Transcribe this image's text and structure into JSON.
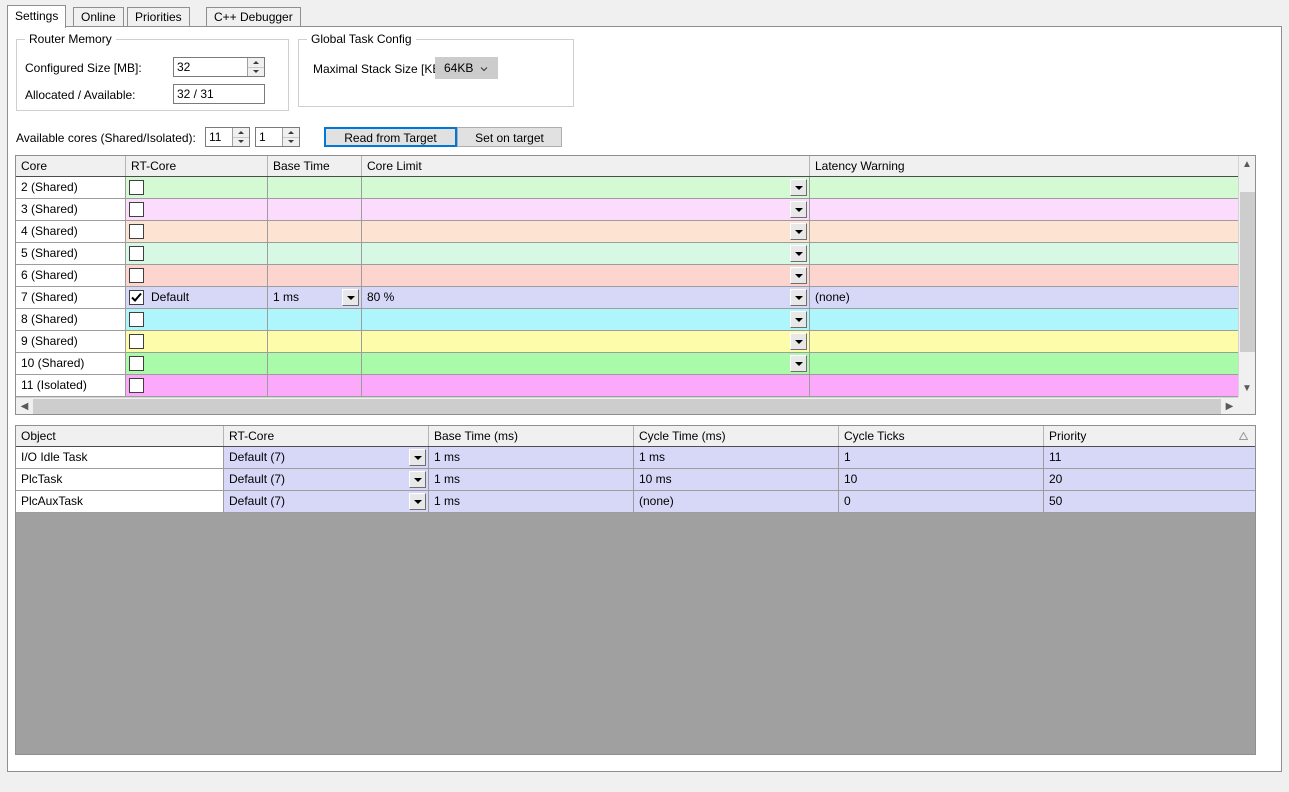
{
  "tabs": [
    {
      "label": "Settings",
      "active": true
    },
    {
      "label": "Online",
      "active": false
    },
    {
      "label": "Priorities",
      "active": false
    },
    {
      "label": "C++ Debugger",
      "active": false
    }
  ],
  "router_memory": {
    "title": "Router Memory",
    "configured_size_label": "Configured Size [MB]:",
    "configured_size_value": "32",
    "allocated_available_label": "Allocated / Available:",
    "allocated_available_value": "32 / 31"
  },
  "global_task_config": {
    "title": "Global Task Config",
    "max_stack_label": "Maximal Stack Size [KB]",
    "max_stack_value": "64KB"
  },
  "cores_row": {
    "label": "Available cores (Shared/Isolated):",
    "shared_value": "11",
    "isolated_value": "1",
    "read_button": "Read from Target",
    "set_button": "Set on target"
  },
  "core_table": {
    "columns": [
      "Core",
      "RT-Core",
      "Base Time",
      "Core Limit",
      "Latency Warning"
    ],
    "rows": [
      {
        "core": "2 (Shared)",
        "checked": false,
        "rt_core": "",
        "base_time": "",
        "core_limit": "",
        "latency_warning": "",
        "has_base_dropdown": false,
        "has_limit_dropdown": true,
        "color": "#d4fad4"
      },
      {
        "core": "3 (Shared)",
        "checked": false,
        "rt_core": "",
        "base_time": "",
        "core_limit": "",
        "latency_warning": "",
        "has_base_dropdown": false,
        "has_limit_dropdown": true,
        "color": "#fcdcfc"
      },
      {
        "core": "4 (Shared)",
        "checked": false,
        "rt_core": "",
        "base_time": "",
        "core_limit": "",
        "latency_warning": "",
        "has_base_dropdown": false,
        "has_limit_dropdown": true,
        "color": "#fde4d2"
      },
      {
        "core": "5 (Shared)",
        "checked": false,
        "rt_core": "",
        "base_time": "",
        "core_limit": "",
        "latency_warning": "",
        "has_base_dropdown": false,
        "has_limit_dropdown": true,
        "color": "#d6f8e5"
      },
      {
        "core": "6 (Shared)",
        "checked": false,
        "rt_core": "",
        "base_time": "",
        "core_limit": "",
        "latency_warning": "",
        "has_base_dropdown": false,
        "has_limit_dropdown": true,
        "color": "#fcd6ce"
      },
      {
        "core": "7 (Shared)",
        "checked": true,
        "rt_core": "Default",
        "base_time": "1 ms",
        "core_limit": "80 %",
        "latency_warning": "(none)",
        "has_base_dropdown": true,
        "has_limit_dropdown": true,
        "color": "#d7d7f8"
      },
      {
        "core": "8 (Shared)",
        "checked": false,
        "rt_core": "",
        "base_time": "",
        "core_limit": "",
        "latency_warning": "",
        "has_base_dropdown": false,
        "has_limit_dropdown": true,
        "color": "#aef5fc"
      },
      {
        "core": "9 (Shared)",
        "checked": false,
        "rt_core": "",
        "base_time": "",
        "core_limit": "",
        "latency_warning": "",
        "has_base_dropdown": false,
        "has_limit_dropdown": true,
        "color": "#fcfcaa"
      },
      {
        "core": "10 (Shared)",
        "checked": false,
        "rt_core": "",
        "base_time": "",
        "core_limit": "",
        "latency_warning": "",
        "has_base_dropdown": false,
        "has_limit_dropdown": true,
        "color": "#a9fba9"
      },
      {
        "core": "11 (Isolated)",
        "checked": false,
        "rt_core": "",
        "base_time": "",
        "core_limit": "",
        "latency_warning": "",
        "has_base_dropdown": false,
        "has_limit_dropdown": false,
        "color": "#fba9fb"
      }
    ]
  },
  "task_table": {
    "columns": [
      "Object",
      "RT-Core",
      "Base Time (ms)",
      "Cycle Time (ms)",
      "Cycle Ticks",
      "Priority"
    ],
    "sorted_column": "Priority",
    "sort_direction": "ascending",
    "rows": [
      {
        "object": "I/O Idle Task",
        "rt_core": "Default (7)",
        "base_time": "1 ms",
        "cycle_time": "1 ms",
        "cycle_ticks": "1",
        "priority": "11"
      },
      {
        "object": "PlcTask",
        "rt_core": "Default (7)",
        "base_time": "1 ms",
        "cycle_time": "10 ms",
        "cycle_ticks": "10",
        "priority": "20"
      },
      {
        "object": "PlcAuxTask",
        "rt_core": "Default (7)",
        "base_time": "1 ms",
        "cycle_time": "(none)",
        "cycle_ticks": "0",
        "priority": "50"
      }
    ],
    "row_color": "#d7d7f8"
  },
  "icons": {
    "spinner_up": "triangle-up-icon",
    "spinner_down": "triangle-down-icon",
    "combo_chevron": "chevron-down-icon",
    "cell_dropdown": "dropdown-arrow-icon",
    "scroll_up": "scroll-up-arrow-icon",
    "scroll_down": "scroll-down-arrow-icon",
    "scroll_left": "scroll-left-arrow-icon",
    "scroll_right": "scroll-right-arrow-icon",
    "sort_ascending": "sort-ascending-icon",
    "checkmark": "checkmark-icon"
  },
  "colors": {
    "focus_accent": "#0078d7",
    "grid_body_grey": "#a0a0a0",
    "header_grey": "#f0f0f0",
    "selected_row": "#d7d7f8"
  }
}
